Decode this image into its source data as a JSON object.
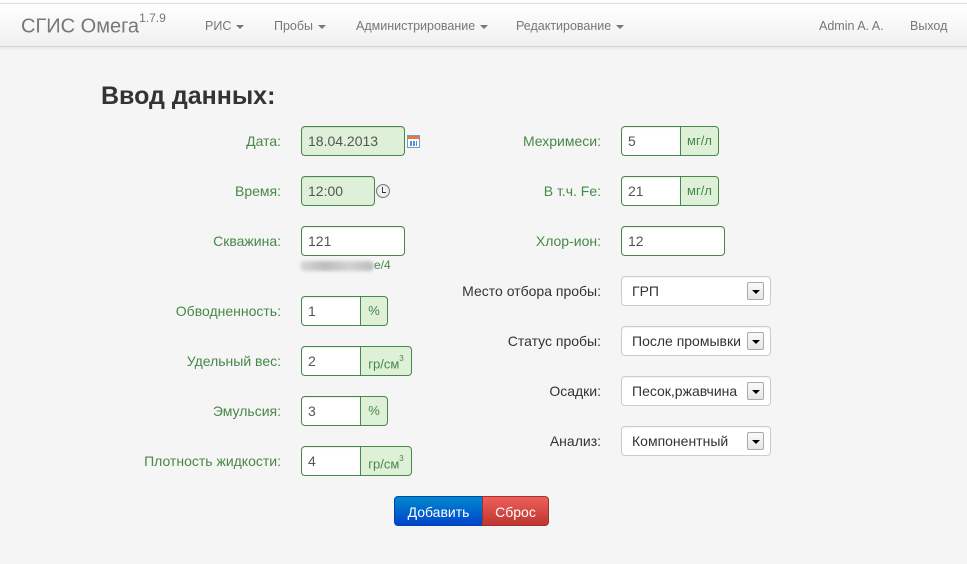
{
  "app": {
    "title": "СГИС Омега",
    "version": "1.7.9"
  },
  "nav": {
    "menus": [
      "РИС",
      "Пробы",
      "Администрирование",
      "Редактирование"
    ],
    "user": "Admin A. A.",
    "logout": "Выход"
  },
  "page_title": "Ввод данных:",
  "left": {
    "date": {
      "label": "Дата:",
      "value": "18.04.2013"
    },
    "time": {
      "label": "Время:",
      "value": "12:00"
    },
    "well": {
      "label": "Скважина:",
      "value": "121",
      "hint_suffix": "е/4"
    },
    "watercut": {
      "label": "Обводненность:",
      "value": "1",
      "unit": "%"
    },
    "spec_weight": {
      "label": "Удельный вес:",
      "value": "2",
      "unit": "гр/см",
      "unit_sup": "3"
    },
    "emulsion": {
      "label": "Эмульсия:",
      "value": "3",
      "unit": "%"
    },
    "density": {
      "label": "Плотность жидкости:",
      "value": "4",
      "unit": "гр/см",
      "unit_sup": "3"
    }
  },
  "right": {
    "mech": {
      "label": "Мехримеси:",
      "value": "5",
      "unit": "мг/л"
    },
    "fe": {
      "label": "В т.ч. Fe:",
      "value": "21",
      "unit": "мг/л"
    },
    "chlor": {
      "label": "Хлор-ион:",
      "value": "12"
    },
    "place": {
      "label": "Место отбора пробы:",
      "value": "ГРП"
    },
    "status": {
      "label": "Статус пробы:",
      "value": "После промывки"
    },
    "sediment": {
      "label": "Осадки:",
      "value": "Песок,ржавчина"
    },
    "analysis": {
      "label": "Анализ:",
      "value": "Компонентный"
    }
  },
  "buttons": {
    "add": "Добавить",
    "reset": "Сброс"
  }
}
